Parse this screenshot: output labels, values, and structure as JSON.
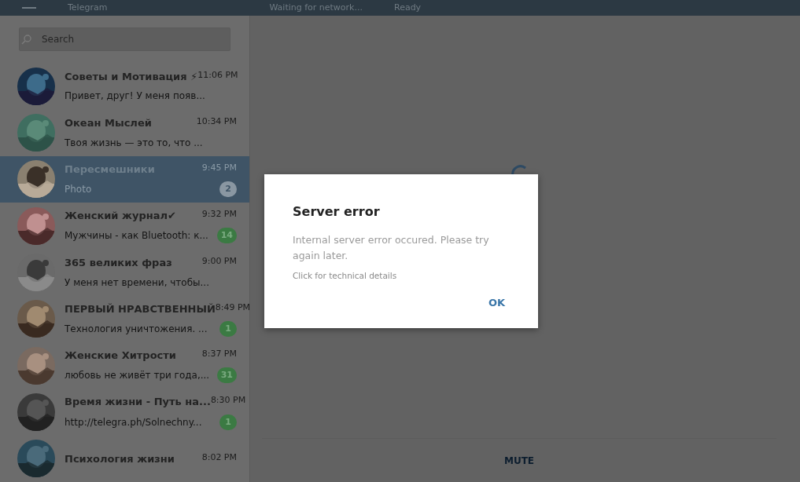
{
  "header": {
    "title": "Telegram",
    "status": "Waiting for network...",
    "state": "Ready"
  },
  "search": {
    "placeholder": "Search"
  },
  "chats": [
    {
      "name": "Советы и Мотивация ⚡",
      "time": "11:06 PM",
      "preview": "Привет, друг! У меня появ...",
      "selected": false
    },
    {
      "name": "Океан Мыслей",
      "time": "10:34 PM",
      "preview": "Твоя жизнь — это то, что ...",
      "selected": false
    },
    {
      "name": "Пересмешники",
      "time": "9:45 PM",
      "preview": "Photo",
      "unread": "2",
      "selected": true
    },
    {
      "name": "Женский журнал✔",
      "time": "9:32 PM",
      "preview": "Мужчины - как Bluetooth: к...",
      "unread": "14",
      "selected": false
    },
    {
      "name": "365 великих фраз",
      "time": "9:00 PM",
      "preview": "У меня нет времени, чтобы...",
      "selected": false
    },
    {
      "name": "ПЕРВЫЙ НРАВСТВЕННЫЙ",
      "time": "8:49 PM",
      "preview": "Технология уничтожения. ...",
      "unread": "1",
      "selected": false
    },
    {
      "name": "Женские Хитрости",
      "time": "8:37 PM",
      "preview": "любовь не живёт три года,...",
      "unread": "31",
      "selected": false
    },
    {
      "name": "Время жизни - Путь на...",
      "time": "8:30 PM",
      "preview": "http://telegra.ph/Solnechny...",
      "unread": "1",
      "selected": false
    },
    {
      "name": "Психология жизни",
      "time": "8:02 PM",
      "selected": false
    }
  ],
  "footer": {
    "action": "MUTE"
  },
  "dialog": {
    "title": "Server error",
    "message": "Internal server error occured. Please try again later.",
    "details": "Click for technical details",
    "button": "OK"
  }
}
